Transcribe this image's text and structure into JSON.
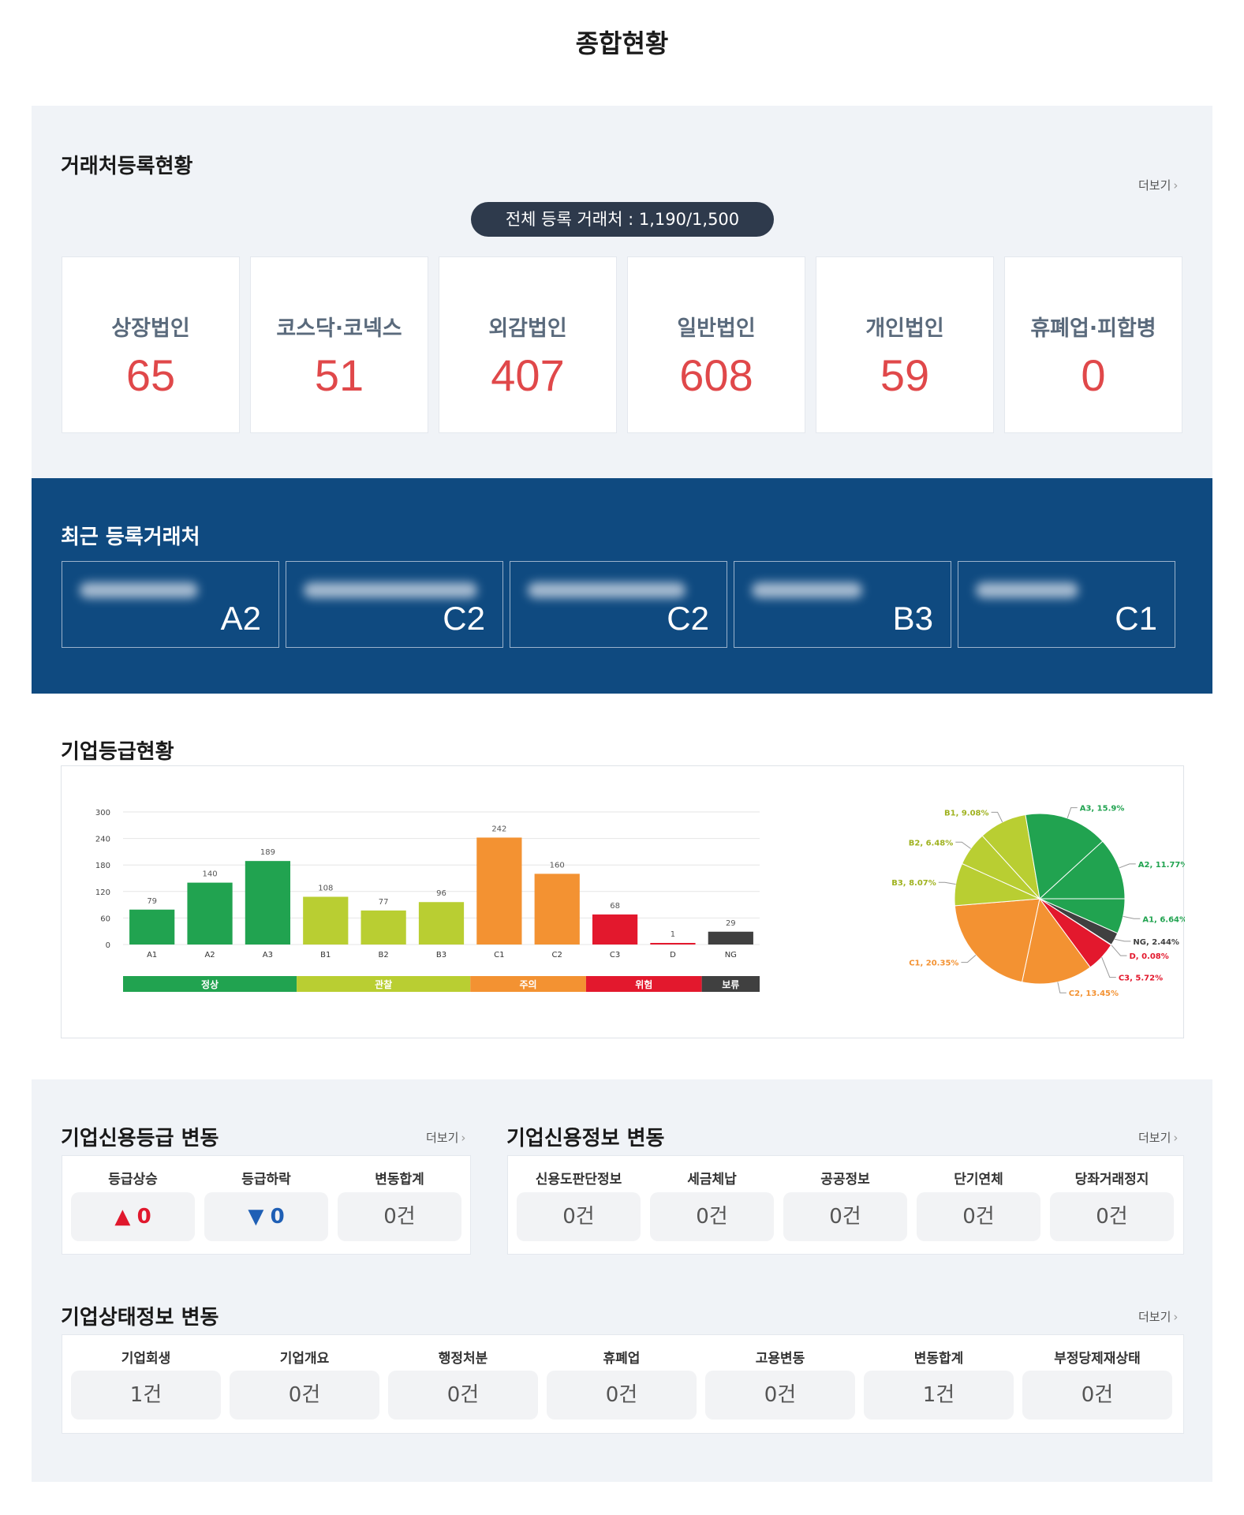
{
  "page_title": "종합현황",
  "registration": {
    "title": "거래처등록현황",
    "more": "더보기",
    "total": "전체 등록 거래처 : 1,190/1,500",
    "cards": [
      {
        "label": "상장법인",
        "value": "65"
      },
      {
        "label": "코스닥·코넥스",
        "value": "51"
      },
      {
        "label": "외감법인",
        "value": "407"
      },
      {
        "label": "일반법인",
        "value": "608"
      },
      {
        "label": "개인법인",
        "value": "59"
      },
      {
        "label": "휴폐업·피합병",
        "value": "0"
      }
    ]
  },
  "recent": {
    "title": "최근 등록거래처",
    "items": [
      {
        "grade": "A2"
      },
      {
        "grade": "C2"
      },
      {
        "grade": "C2"
      },
      {
        "grade": "B3"
      },
      {
        "grade": "C1"
      }
    ]
  },
  "grade_status": {
    "title": "기업등급현황"
  },
  "chart_data": [
    {
      "type": "bar",
      "categories": [
        "A1",
        "A2",
        "A3",
        "B1",
        "B2",
        "B3",
        "C1",
        "C2",
        "C3",
        "D",
        "NG"
      ],
      "values": [
        79,
        140,
        189,
        108,
        77,
        96,
        242,
        160,
        68,
        1,
        29
      ],
      "bar_colors": [
        "#21a350",
        "#21a350",
        "#21a350",
        "#b9ce32",
        "#b9ce32",
        "#b9ce32",
        "#f39232",
        "#f39232",
        "#e3182d",
        "#e3182d",
        "#404040"
      ],
      "yticks": [
        0,
        60,
        120,
        180,
        240,
        300
      ],
      "ylim": [
        0,
        300
      ],
      "grid": true,
      "groups": [
        {
          "label": "정상",
          "count": 3,
          "color": "#21a350"
        },
        {
          "label": "관찰",
          "count": 3,
          "color": "#b9ce32"
        },
        {
          "label": "주의",
          "count": 2,
          "color": "#f39232"
        },
        {
          "label": "위험",
          "count": 2,
          "color": "#e3182d"
        },
        {
          "label": "보류",
          "count": 1,
          "color": "#404040"
        }
      ]
    },
    {
      "type": "pie",
      "slices": [
        {
          "label": "A1, 6.64%",
          "value": 6.64,
          "color": "#21a350",
          "text_color": "#21a350"
        },
        {
          "label": "NG, 2.44%",
          "value": 2.44,
          "color": "#404040",
          "text_color": "#404040"
        },
        {
          "label": "D, 0.08%",
          "value": 0.08,
          "color": "#e3182d",
          "text_color": "#e3182d"
        },
        {
          "label": "C3, 5.72%",
          "value": 5.72,
          "color": "#e3182d",
          "text_color": "#e3182d"
        },
        {
          "label": "C2, 13.45%",
          "value": 13.45,
          "color": "#f39232",
          "text_color": "#f39232"
        },
        {
          "label": "C1, 20.35%",
          "value": 20.35,
          "color": "#f39232",
          "text_color": "#f39232"
        },
        {
          "label": "B3, 8.07%",
          "value": 8.07,
          "color": "#b9ce32",
          "text_color": "#9fb21f"
        },
        {
          "label": "B2, 6.48%",
          "value": 6.48,
          "color": "#b9ce32",
          "text_color": "#9fb21f"
        },
        {
          "label": "B1, 9.08%",
          "value": 9.08,
          "color": "#b9ce32",
          "text_color": "#9fb21f"
        },
        {
          "label": "A3, 15.9%",
          "value": 15.9,
          "color": "#21a350",
          "text_color": "#21a350"
        },
        {
          "label": "A2, 11.77%",
          "value": 11.77,
          "color": "#21a350",
          "text_color": "#21a350"
        }
      ]
    }
  ],
  "credit_grade_change": {
    "title": "기업신용등급 변동",
    "more": "더보기",
    "cells": [
      {
        "label": "등급상승",
        "value": "0",
        "arrow": "▲"
      },
      {
        "label": "등급하락",
        "value": "0",
        "arrow": "▼"
      },
      {
        "label": "변동합계",
        "value": "0건"
      }
    ]
  },
  "credit_info_change": {
    "title": "기업신용정보 변동",
    "more": "더보기",
    "cells": [
      {
        "label": "신용도판단정보",
        "value": "0건"
      },
      {
        "label": "세금체납",
        "value": "0건"
      },
      {
        "label": "공공정보",
        "value": "0건"
      },
      {
        "label": "단기연체",
        "value": "0건"
      },
      {
        "label": "당좌거래정지",
        "value": "0건"
      }
    ]
  },
  "status_change": {
    "title": "기업상태정보 변동",
    "more": "더보기",
    "cells": [
      {
        "label": "기업회생",
        "value": "1건"
      },
      {
        "label": "기업개요",
        "value": "0건"
      },
      {
        "label": "행정처분",
        "value": "0건"
      },
      {
        "label": "휴폐업",
        "value": "0건"
      },
      {
        "label": "고용변동",
        "value": "0건"
      },
      {
        "label": "변동합계",
        "value": "1건"
      },
      {
        "label": "부정당제재상태",
        "value": "0건"
      }
    ]
  }
}
